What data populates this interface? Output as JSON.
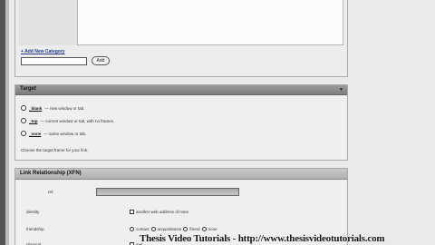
{
  "category": {
    "add_link": "+ Add New Category",
    "add_button": "Add"
  },
  "target": {
    "title": "Target",
    "options": [
      {
        "code": "_blank",
        "desc": "— new window or tab."
      },
      {
        "code": "_top",
        "desc": "— current window or tab, with no frames."
      },
      {
        "code": "_none",
        "desc": "— same window or tab."
      }
    ],
    "note": "Choose the target frame for your link."
  },
  "xfn": {
    "title": "Link Relationship (XFN)",
    "rel_label": "rel:",
    "rows": [
      {
        "label": "identity",
        "options": [
          "another web address of mine"
        ]
      },
      {
        "label": "friendship",
        "options": [
          "contact",
          "acquaintance",
          "friend",
          "none"
        ]
      },
      {
        "label": "physical",
        "options": [
          "met"
        ]
      }
    ]
  },
  "watermark": "Thesis Video Tutorials - http://www.thesisvideotutorials.com"
}
